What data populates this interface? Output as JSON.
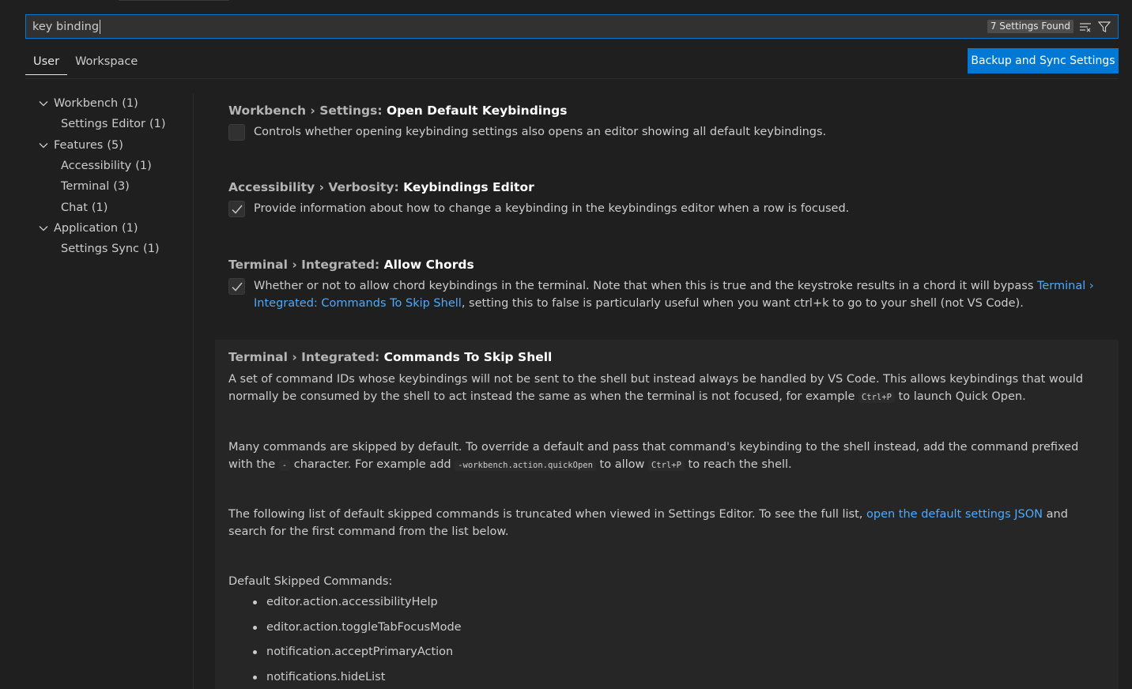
{
  "search": {
    "value": "key binding",
    "results_badge": "7 Settings Found"
  },
  "tabs": [
    {
      "label": "User",
      "active": true
    },
    {
      "label": "Workspace",
      "active": false
    }
  ],
  "sync_button": {
    "label": "Backup and Sync Settings"
  },
  "toc": [
    {
      "label": "Workbench",
      "count": "(1)",
      "level": 0,
      "expanded": true
    },
    {
      "label": "Settings Editor",
      "count": "(1)",
      "level": 1
    },
    {
      "label": "Features",
      "count": "(5)",
      "level": 0,
      "expanded": true
    },
    {
      "label": "Accessibility",
      "count": "(1)",
      "level": 1
    },
    {
      "label": "Terminal",
      "count": "(3)",
      "level": 1
    },
    {
      "label": "Chat",
      "count": "(1)",
      "level": 1
    },
    {
      "label": "Application",
      "count": "(1)",
      "level": 0,
      "expanded": true
    },
    {
      "label": "Settings Sync",
      "count": "(1)",
      "level": 1
    }
  ],
  "settings": {
    "s1": {
      "category": "Workbench › Settings: ",
      "name": "Open Default Keybindings",
      "checked": false,
      "description": "Controls whether opening keybinding settings also opens an editor showing all default keybindings."
    },
    "s2": {
      "category": "Accessibility › Verbosity: ",
      "name": "Keybindings Editor",
      "checked": true,
      "description": "Provide information about how to change a keybinding in the keybindings editor when a row is focused."
    },
    "s3": {
      "category": "Terminal › Integrated: ",
      "name": "Allow Chords",
      "checked": true,
      "desc_before": "Whether or not to allow chord keybindings in the terminal. Note that when this is true and the keystroke results in a chord it will bypass ",
      "desc_link": "Terminal › Integrated: Commands To Skip Shell",
      "desc_after": ", setting this to false is particularly useful when you want ctrl+k to go to your shell (not VS Code)."
    },
    "s4": {
      "category": "Terminal › Integrated: ",
      "name": "Commands To Skip Shell",
      "p1_before": "A set of command IDs whose keybindings will not be sent to the shell but instead always be handled by VS Code. This allows keybindings that would normally be consumed by the shell to act instead the same as when the terminal is not focused, for example ",
      "p1_code": "Ctrl+P",
      "p1_after": " to launch Quick Open.",
      "p2_before": "Many commands are skipped by default. To override a default and pass that command's keybinding to the shell instead, add the command prefixed with the ",
      "p2_code1": "-",
      "p2_mid1": " character. For example add ",
      "p2_code2": "-workbench.action.quickOpen",
      "p2_mid2": " to allow ",
      "p2_code3": "Ctrl+P",
      "p2_after": " to reach the shell.",
      "p3_before": "The following list of default skipped commands is truncated when viewed in Settings Editor. To see the full list, ",
      "p3_link": "open the default settings JSON",
      "p3_after": " and search for the first command from the list below.",
      "list_heading": "Default Skipped Commands:",
      "commands": [
        "editor.action.accessibilityHelp",
        "editor.action.toggleTabFocusMode",
        "notification.acceptPrimaryAction",
        "notifications.hideList"
      ]
    }
  },
  "colors": {
    "accent": "#0078d4",
    "link": "#4daafc",
    "background": "#1f1f1f"
  }
}
